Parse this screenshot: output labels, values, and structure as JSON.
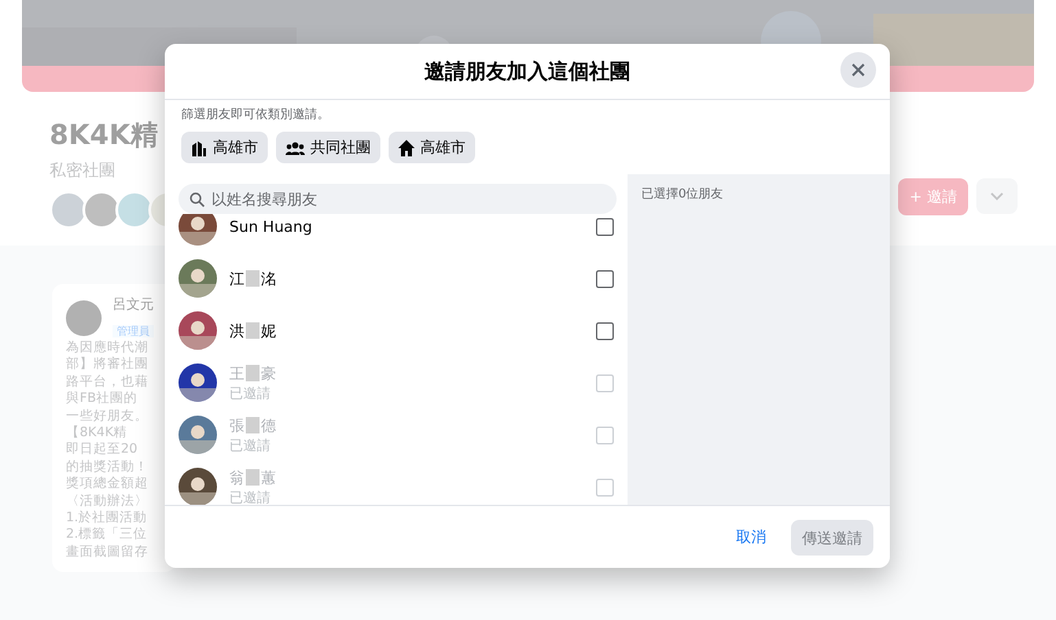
{
  "page": {
    "group_title": "8K4K精",
    "group_meta": "私密社團",
    "invite_button": "+ 邀請",
    "post": {
      "author": "呂文元",
      "role": "管理員",
      "lines": [
        "為因應時代潮",
        "部】將審社團",
        "路平台，也藉",
        "與FB社團的",
        "一些好朋友。",
        "【8K4K精",
        "即日起至20",
        "的抽獎活動！",
        "獎項總金額超",
        "〈活動辦法〉",
        "1.於社團活動",
        "2.標籤「三位",
        "畫面截圖留存"
      ]
    }
  },
  "dialog": {
    "title": "邀請朋友加入這個社團",
    "filter_hint": "篩選朋友即可依類別邀請。",
    "filters": [
      {
        "kind": "city",
        "label": "高雄市"
      },
      {
        "kind": "groups",
        "label": "共同社團"
      },
      {
        "kind": "home",
        "label": "高雄市"
      }
    ],
    "search": {
      "placeholder": "以姓名搜尋朋友"
    },
    "friends": [
      {
        "name_start": "Sun Huang",
        "checked": false,
        "disabled": false
      },
      {
        "name_start": "江",
        "name_end": "洺",
        "checked": false,
        "disabled": false
      },
      {
        "name_start": "洪",
        "name_end": "妮",
        "checked": false,
        "disabled": false
      },
      {
        "name_start": "王",
        "name_end": "豪",
        "checked": false,
        "disabled": true,
        "note": "已邀請"
      },
      {
        "name_start": "張",
        "name_end": "德",
        "checked": false,
        "disabled": true,
        "note": "已邀請"
      },
      {
        "name_start": "翁",
        "name_end": "蕙",
        "checked": false,
        "disabled": true,
        "note": "已邀請"
      }
    ],
    "selected_summary": "已選擇0位朋友",
    "cancel": "取消",
    "send": {
      "label": "傳送邀請",
      "disabled": true
    }
  }
}
